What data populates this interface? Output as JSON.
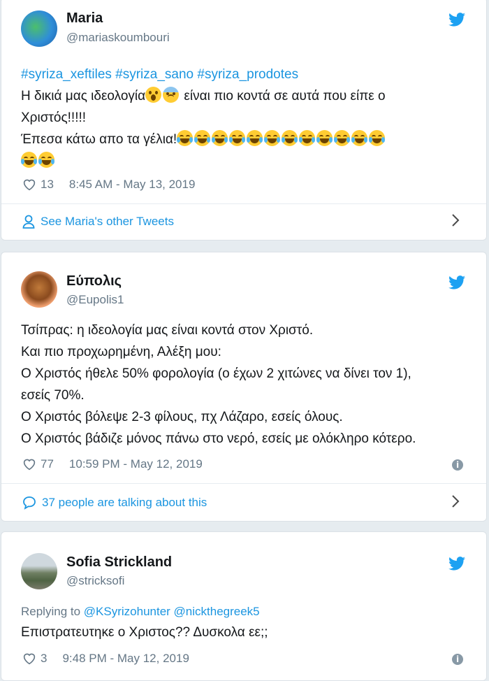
{
  "tweets": [
    {
      "name": "Maria",
      "handle": "@mariaskoumbouri",
      "hashtags": "#syriza_xeftiles #syriza_sano #syriza_prodotes",
      "line1": "Η δικιά μας ιδεολογία",
      "line1b": " είναι πιο κοντά σε αυτά που είπε ο",
      "line2": "Χριστός!!!!!",
      "line3": "Έπεσα κάτω απο τα γέλια!",
      "likes": "13",
      "time": "8:45 AM - May 13, 2019",
      "footer": "See Maria's other Tweets"
    },
    {
      "name": "Εύπολις",
      "handle": "@Eupolis1",
      "lines": [
        "Τσίπρας: η ιδεολογία μας είναι κοντά στον Χριστό.",
        "Και πιο προχωρημένη, Αλέξη μου:",
        "Ο Χριστός ήθελε 50% φορολογία (ο έχων 2 χιτώνες να δίνει τον 1),",
        "εσείς 70%.",
        "Ο Χριστός βόλεψε 2-3 φίλους, πχ Λάζαρο, εσείς όλους.",
        "Ο Χριστός βάδιζε μόνος πάνω στο νερό, εσείς με ολόκληρο κότερο."
      ],
      "likes": "77",
      "time": "10:59 PM - May 12, 2019",
      "footer": "37 people are talking about this"
    },
    {
      "name": "Sofia Strickland",
      "handle": "@stricksofi",
      "replying_prefix": "Replying to ",
      "replying_to": "@KSyrizohunter @nickthegreek5",
      "text": "Επιστρατευτηκε ο Χριστος??  Δυσκολα εε;;",
      "likes": "3",
      "time": "9:48 PM - May 12, 2019"
    }
  ],
  "colors": {
    "accent": "#1b95e0",
    "muted": "#657786",
    "background": "#e6ecf0"
  },
  "icons": [
    "twitter-bird-icon",
    "heart-icon",
    "person-icon",
    "speech-bubble-icon",
    "chevron-right-icon",
    "info-icon"
  ]
}
